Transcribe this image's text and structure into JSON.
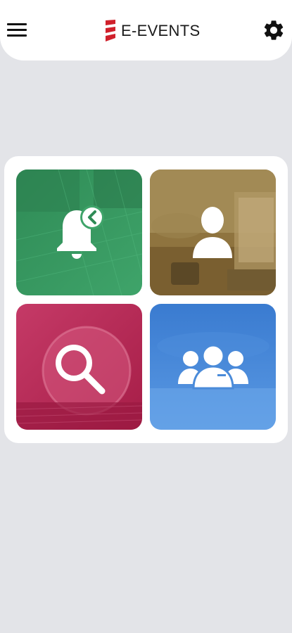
{
  "app": {
    "title": "E-EVENTS",
    "brand_color": "#d0202b"
  },
  "header": {
    "menu_icon": "hamburger-menu-icon",
    "settings_icon": "gear-icon"
  },
  "tiles": [
    {
      "id": "notifications",
      "icon": "bell-back-icon",
      "color": "#3a9a5c"
    },
    {
      "id": "profile",
      "icon": "user-icon",
      "color": "#8c6f3c"
    },
    {
      "id": "search",
      "icon": "magnifier-icon",
      "color": "#c2325e"
    },
    {
      "id": "participants",
      "icon": "group-icon",
      "color": "#3f82d6"
    }
  ]
}
